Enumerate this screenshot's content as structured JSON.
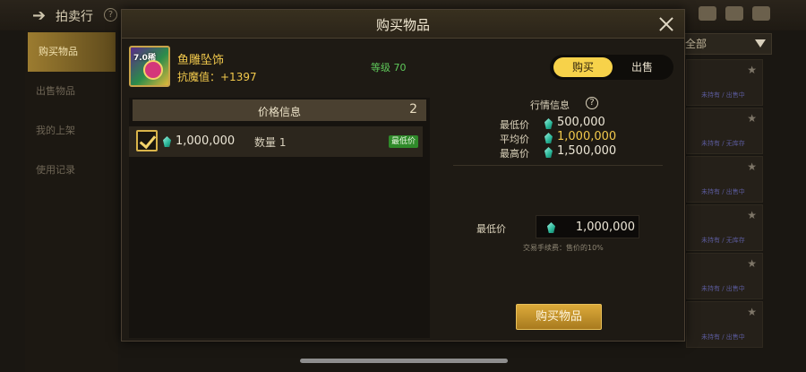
{
  "background": {
    "title": "拍卖行",
    "help": "?",
    "sidebar": [
      {
        "label": "购买物品",
        "active": true
      },
      {
        "label": "出售物品",
        "active": false
      },
      {
        "label": "我的上架",
        "active": false
      },
      {
        "label": "使用记录",
        "active": false
      }
    ],
    "filter_label": "全部",
    "card_tags": [
      "未持有 / 出售中",
      "未持有 / 无库存",
      "未持有 / 出售中",
      "未持有 / 无库存",
      "未持有 / 出售中",
      "未持有 / 出售中"
    ]
  },
  "modal": {
    "title": "购买物品",
    "item": {
      "icon_text": "7.0稀",
      "name": "鱼雕坠饰",
      "stat": "抗魔值：+1397",
      "level": "等级 70"
    },
    "toggle": {
      "buy": "购买",
      "sell": "出售",
      "selected": "buy"
    },
    "price_info": {
      "header": "价格信息",
      "count": "2",
      "listing": {
        "checked": true,
        "price": "1,000,000",
        "quantity": "数量 1",
        "badge": "最低价"
      }
    },
    "market": {
      "title": "行情信息",
      "help": "?",
      "rows": [
        {
          "label": "最低价",
          "value": "500,000"
        },
        {
          "label": "平均价",
          "value": "1,000,000"
        },
        {
          "label": "最高价",
          "value": "1,500,000"
        }
      ],
      "min_price_label": "最低价",
      "min_price_value": "1,000,000",
      "fee_note": "交易手续费：售价的10%"
    },
    "buy_button": "购买物品"
  },
  "colors": {
    "accent_gold": "#f7d24a",
    "item_name": "#f2c94c",
    "level_green": "#5fc85a",
    "badge_green": "#2f8a2a",
    "gem": "#2bb89a"
  }
}
